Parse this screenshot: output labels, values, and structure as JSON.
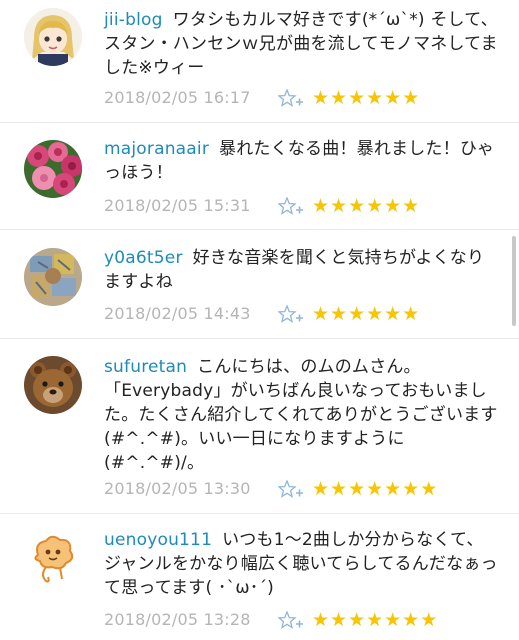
{
  "comments": [
    {
      "user": "jii-blog",
      "text": "ワタシもカルマ好きです(*´ω`*) そして、スタン・ハンセンｗ兄が曲を流してモノマネしてました※ウィー",
      "timestamp": "2018/02/05 16:17",
      "stars": "★★★★★★",
      "avatar_icon": "anime-girl-avatar"
    },
    {
      "user": "majoranaair",
      "text": "暴れたくなる曲！暴れました！ひゃっほう！",
      "timestamp": "2018/02/05 15:31",
      "stars": "★★★★★★",
      "avatar_icon": "roses-avatar"
    },
    {
      "user": "y0a6t5er",
      "text": "好きな音楽を聞くと気持ちがよくなりますよね",
      "timestamp": "2018/02/05 14:43",
      "stars": "★★★★★★",
      "avatar_icon": "mosaic-avatar"
    },
    {
      "user": "sufuretan",
      "text": "こんにちは、のムのムさん。「Everybady」がいちばん良いなっておもいました。たくさん紹介してくれてありがとうございます(#^.^#)。いい一日になりますように(#^.^#)/。",
      "timestamp": "2018/02/05 13:30",
      "stars": "★★★★★★★",
      "avatar_icon": "teddy-bear-avatar"
    },
    {
      "user": "uenoyou111",
      "text": "いつも1～2曲しか分からなくて、ジャンルをかなり幅広く聴いてらしてるんだなぁって思ってます( ･`ω･´)",
      "timestamp": "2018/02/05 13:28",
      "stars": "★★★★★★★",
      "avatar_icon": "cartoon-character-avatar"
    }
  ]
}
